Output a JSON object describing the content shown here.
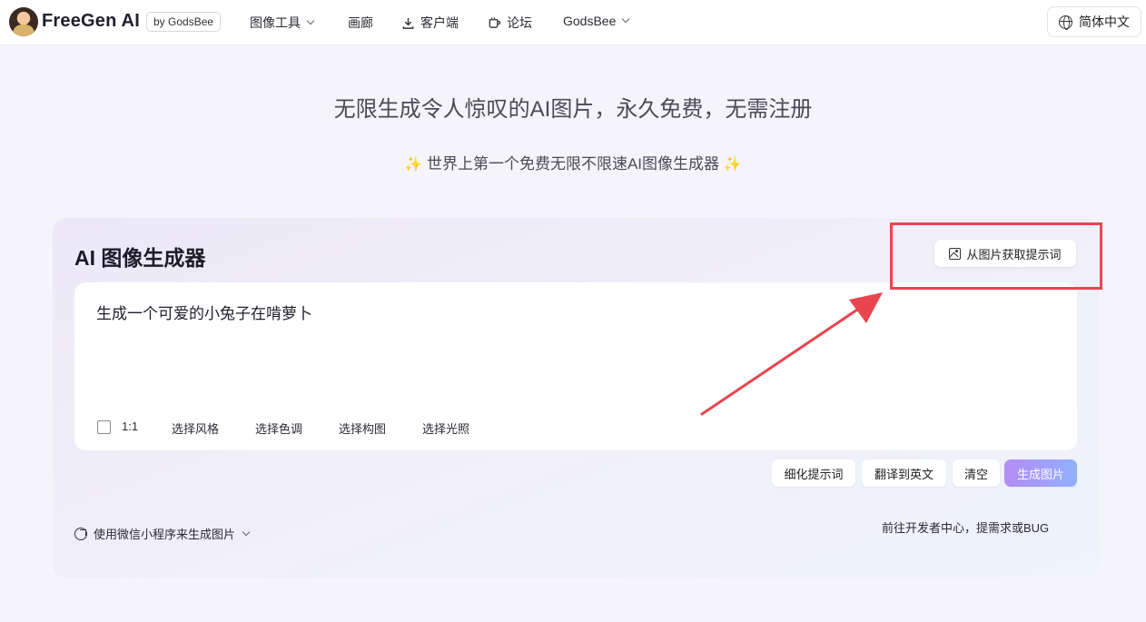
{
  "header": {
    "brand": "FreeGen AI",
    "byline": "by GodsBee",
    "nav": [
      "图像工具",
      "画廊",
      "客户端",
      "论坛",
      "GodsBee"
    ],
    "language": "简体中文"
  },
  "hero": {
    "title": "无限生成令人惊叹的AI图片，永久免费，无需注册",
    "subtitle": "世界上第一个免费无限不限速AI图像生成器",
    "sparkle": "✨"
  },
  "generator": {
    "title": "AI 图像生成器",
    "prompt_from_image": "从图片获取提示词",
    "prompt_value": "生成一个可爱的小兔子在啃萝卜",
    "ratio": "1:1",
    "options": [
      "选择风格",
      "选择色调",
      "选择构图",
      "选择光照"
    ],
    "buttons": {
      "refine": "细化提示词",
      "translate": "翻译到英文",
      "clear": "清空",
      "generate": "生成图片"
    },
    "miniprogram": "使用微信小程序来生成图片",
    "dev_link": "前往开发者中心，提需求或BUG"
  },
  "annotation": {
    "color": "#e8454f"
  }
}
